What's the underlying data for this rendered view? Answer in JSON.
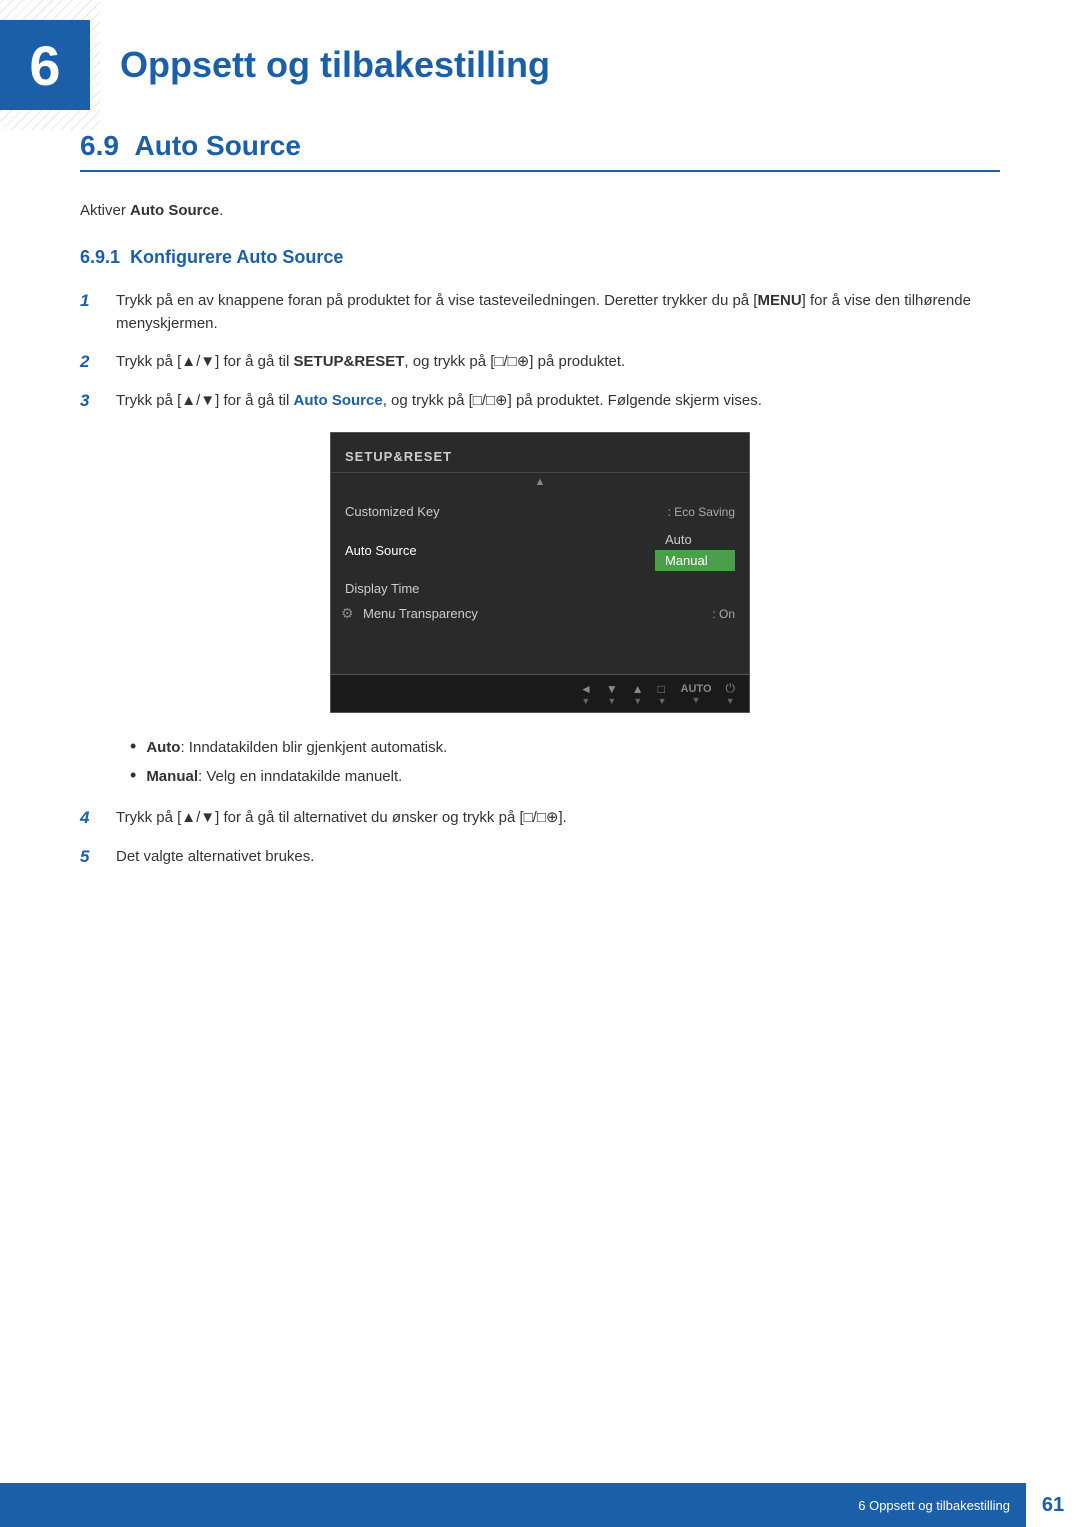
{
  "chapter": {
    "number": "6",
    "title": "Oppsett og tilbakestilling",
    "section_number": "6.9",
    "section_title": "Auto Source",
    "intro_text": "Aktiver ",
    "intro_bold": "Auto Source",
    "intro_end": ".",
    "subsection_number": "6.9.1",
    "subsection_title": "Konfigurere Auto Source"
  },
  "steps": [
    {
      "number": "1",
      "text": "Trykk på en av knappene foran på produktet for å vise tasteveiledningen. Deretter trykker du på [",
      "bold1": "MENU",
      "text2": "] for å vise den tilhørende menyskjermen."
    },
    {
      "number": "2",
      "text": "Trykk på [▲/▼] for å gå til ",
      "bold1": "SETUP&RESET",
      "text2": ", og trykk på [□/□⊕] på produktet."
    },
    {
      "number": "3",
      "text": "Trykk på [▲/▼] for å gå til ",
      "bold1": "Auto Source",
      "text2": ", og trykk på [□/□⊕] på produktet. Følgende skjerm vises."
    }
  ],
  "screenshot": {
    "title": "SETUP&RESET",
    "menu_items": [
      {
        "label": "Customized Key",
        "value": ": Eco Saving"
      },
      {
        "label": "Auto Source",
        "value": ""
      },
      {
        "label": "Display Time",
        "value": ""
      },
      {
        "label": "Menu Transparency",
        "value": ": On"
      }
    ],
    "submenu_options": [
      "Auto",
      "Manual"
    ],
    "submenu_highlight": 1,
    "bottom_icons": [
      "◄",
      "▼",
      "▲",
      "□",
      "AUTO",
      "⏻"
    ]
  },
  "bullets": [
    {
      "bold": "Auto",
      "text": ": Inndatakilden blir gjenkjent automatisk."
    },
    {
      "bold": "Manual",
      "text": ": Velg en inndatakilde manuelt."
    }
  ],
  "steps_continued": [
    {
      "number": "4",
      "text": "Trykk på [▲/▼] for å gå til alternativet du ønsker og trykk på [□/□⊕]."
    },
    {
      "number": "5",
      "text": "Det valgte alternativet brukes."
    }
  ],
  "footer": {
    "text": "6 Oppsett og tilbakestilling",
    "page_number": "61"
  }
}
